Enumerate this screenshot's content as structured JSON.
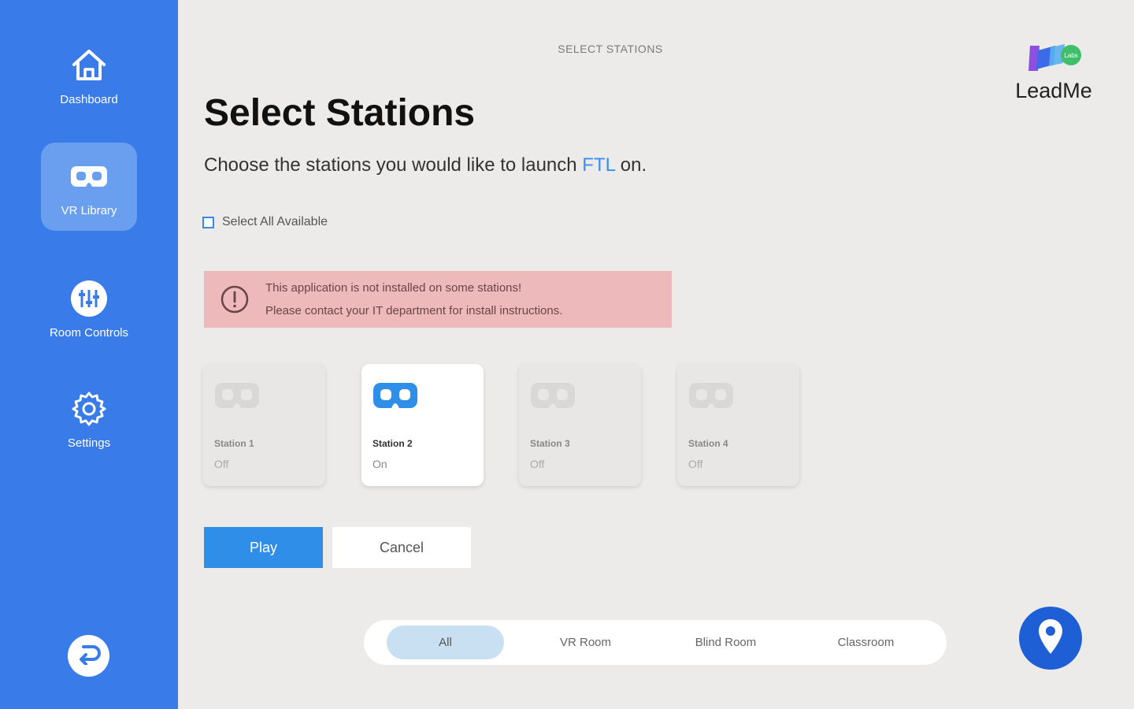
{
  "sidebar": {
    "items": [
      {
        "label": "Dashboard",
        "icon": "home-icon"
      },
      {
        "label": "VR Library",
        "icon": "vr-headset-icon"
      },
      {
        "label": "Room Controls",
        "icon": "sliders-icon"
      },
      {
        "label": "Settings",
        "icon": "gear-icon"
      }
    ],
    "back_icon": "back-arrow-icon"
  },
  "header": {
    "caption": "SELECT STATIONS",
    "logo_text": "LeadMe",
    "logo_badge": "Labs"
  },
  "main": {
    "title": "Select Stations",
    "subtitle_before": "Choose the stations you would like to launch ",
    "subtitle_app": "FTL",
    "subtitle_after": " on.",
    "select_all_label": "Select All Available",
    "alert": {
      "line1": "This application is not installed on some stations!",
      "line2": "Please contact your IT department for install instructions."
    },
    "stations": [
      {
        "name": "Station 1",
        "state": "Off"
      },
      {
        "name": "Station 2",
        "state": "On"
      },
      {
        "name": "Station 3",
        "state": "Off"
      },
      {
        "name": "Station 4",
        "state": "Off"
      }
    ],
    "play_label": "Play",
    "cancel_label": "Cancel"
  },
  "room_filter": {
    "tabs": [
      "All",
      "VR Room",
      "Blind Room",
      "Classroom"
    ],
    "selected": "All"
  },
  "colors": {
    "sidebar": "#3a7bea",
    "accent": "#2f8fe8",
    "alert_bg": "#eeb9ba",
    "location_button": "#1f5fd6"
  }
}
